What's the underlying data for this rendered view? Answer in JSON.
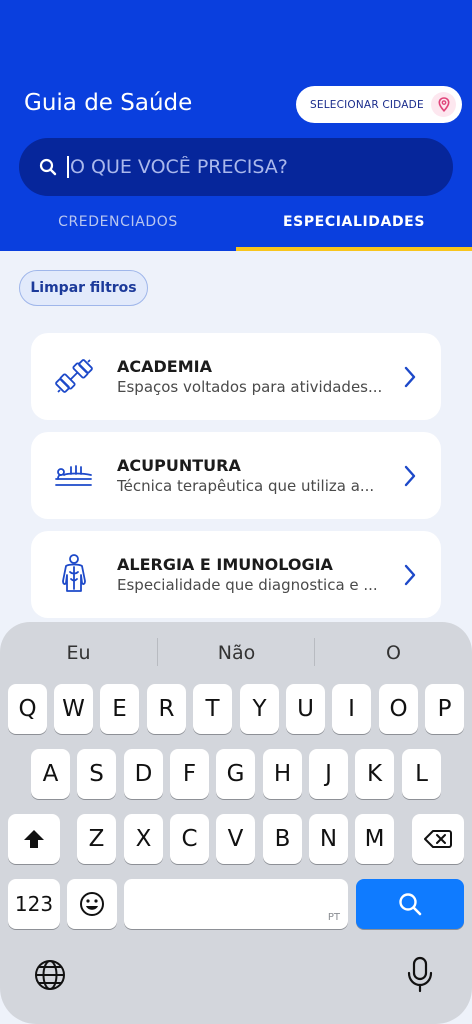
{
  "header": {
    "title": "Guia de Saúde",
    "city_button": "SELECIONAR CIDADE",
    "search_placeholder": "O QUE VOCÊ PRECISA?",
    "tabs": [
      {
        "label": "CREDENCIADOS",
        "active": false
      },
      {
        "label": "ESPECIALIDADES",
        "active": true
      }
    ]
  },
  "filters": {
    "clear_label": "Limpar filtros"
  },
  "specialties": [
    {
      "title": "ACADEMIA",
      "description": "Espaços voltados para atividades...",
      "icon": "dumbbell-icon"
    },
    {
      "title": "ACUPUNTURA",
      "description": "Técnica terapêutica que utiliza a...",
      "icon": "acupuncture-icon"
    },
    {
      "title": "ALERGIA E IMUNOLOGIA",
      "description": "Especialidade que diagnostica e ...",
      "icon": "body-icon"
    }
  ],
  "keyboard": {
    "suggestions": [
      "Eu",
      "Não",
      "O"
    ],
    "row1": [
      "Q",
      "W",
      "E",
      "R",
      "T",
      "Y",
      "U",
      "I",
      "O",
      "P"
    ],
    "row2": [
      "A",
      "S",
      "D",
      "F",
      "G",
      "H",
      "J",
      "K",
      "L"
    ],
    "row3": [
      "Z",
      "X",
      "C",
      "V",
      "B",
      "N",
      "M"
    ],
    "numbers_key": "123",
    "space_lang": "PT"
  },
  "colors": {
    "primary": "#0a3fde",
    "accent": "#f8c51c",
    "key_blue": "#0f7bff"
  }
}
